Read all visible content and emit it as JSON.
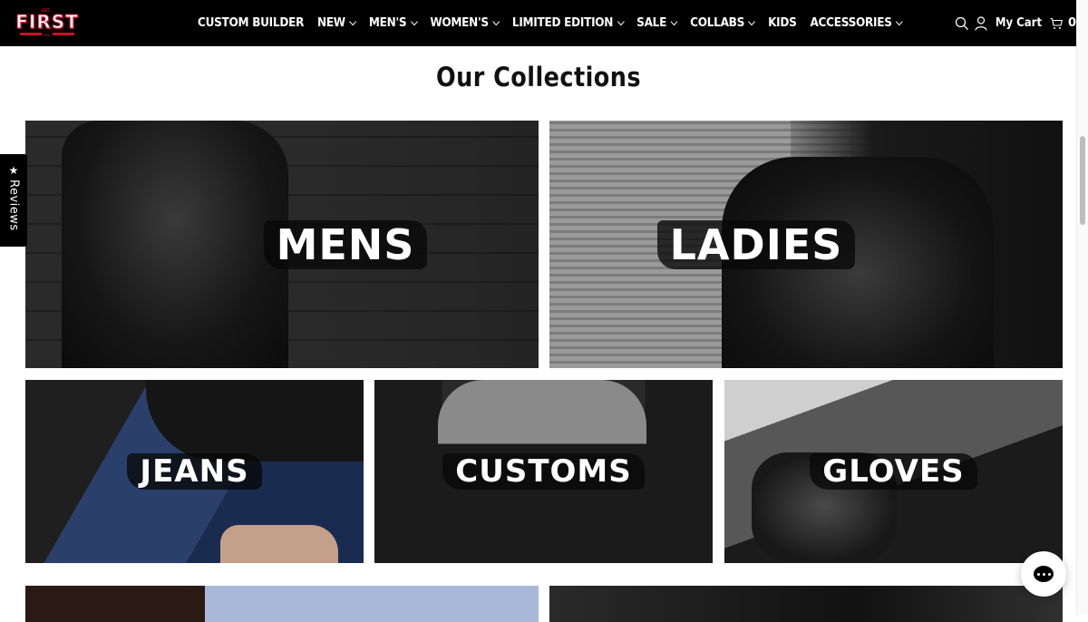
{
  "header": {
    "logo": {
      "top_left": "EST.",
      "top_right": "",
      "word": "FIRST",
      "sub": "CO."
    },
    "menu": [
      {
        "label": "CUSTOM BUILDER",
        "dropdown": false
      },
      {
        "label": "NEW",
        "dropdown": true
      },
      {
        "label": "MEN'S",
        "dropdown": true
      },
      {
        "label": "WOMEN'S",
        "dropdown": true
      },
      {
        "label": "LIMITED EDITION",
        "dropdown": true
      },
      {
        "label": "SALE",
        "dropdown": true
      },
      {
        "label": "COLLABS",
        "dropdown": true
      },
      {
        "label": "KIDS",
        "dropdown": false
      },
      {
        "label": "ACCESSORIES",
        "dropdown": true
      }
    ],
    "cart": {
      "label": "My Cart",
      "count": "0"
    }
  },
  "section": {
    "title": "Our Collections"
  },
  "collections": [
    {
      "label": "MENS"
    },
    {
      "label": "LADIES"
    },
    {
      "label": "JEANS"
    },
    {
      "label": "CUSTOMS"
    },
    {
      "label": "GLOVES"
    }
  ],
  "reviews_tab": {
    "icon": "★",
    "label": "Reviews"
  },
  "icons": {
    "search": "search-icon",
    "account": "user-icon",
    "cart": "cart-icon",
    "chat": "chat-icon"
  },
  "colors": {
    "nav_bg": "#000000",
    "brand_red": "#c8102e",
    "title": "#111111"
  }
}
